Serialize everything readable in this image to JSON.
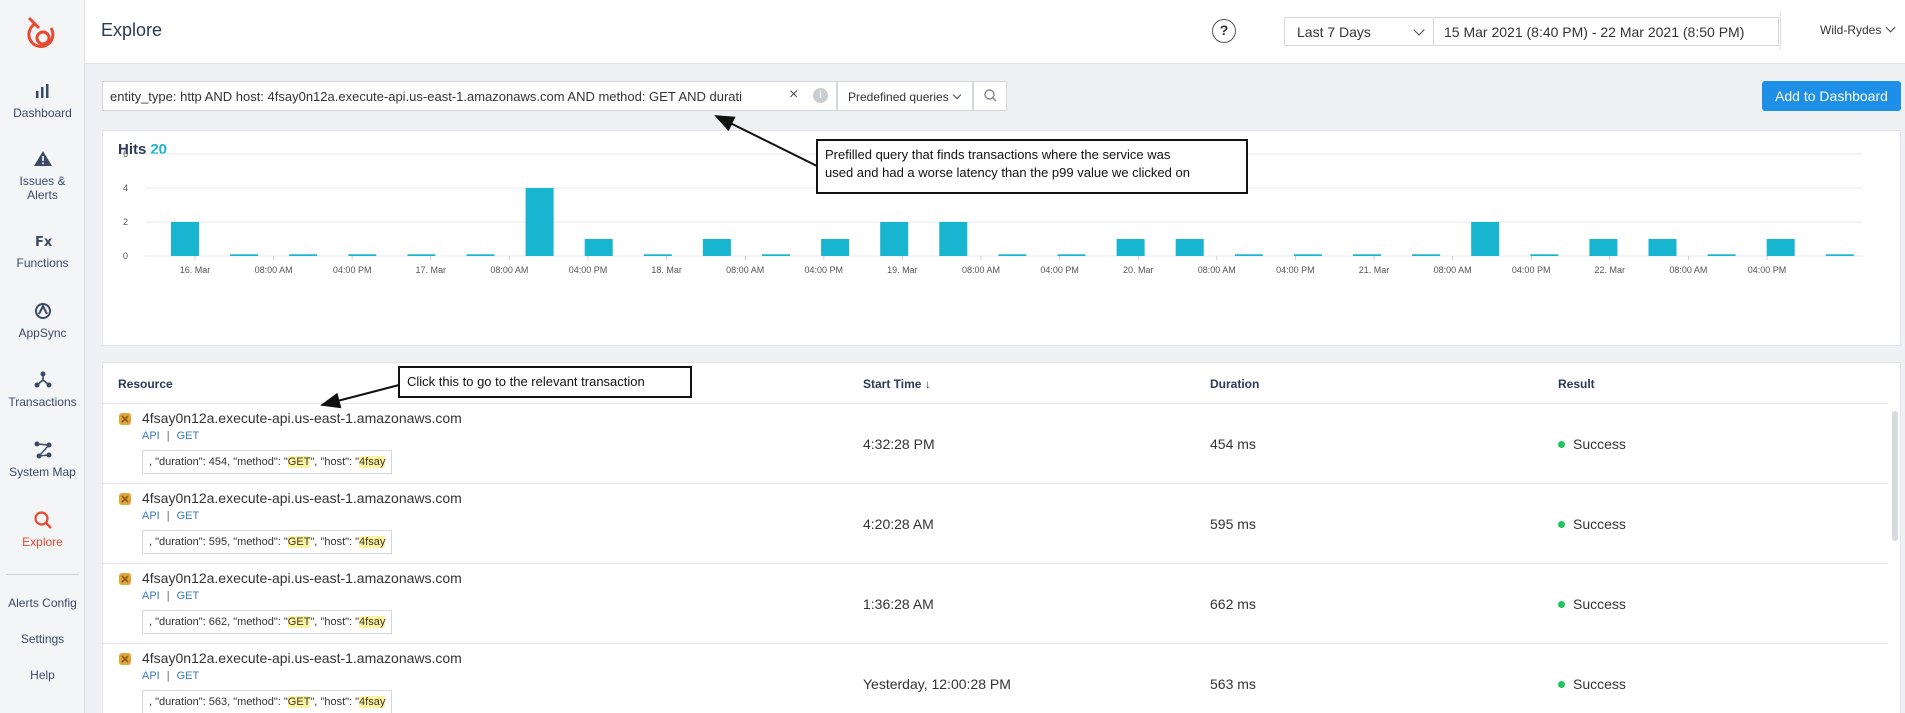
{
  "sidebar": {
    "items": [
      {
        "label": "Dashboard",
        "icon": "bar-chart-icon"
      },
      {
        "label": "Issues &\nAlerts",
        "icon": "warning-icon"
      },
      {
        "label": "Functions",
        "icon": "fx-icon"
      },
      {
        "label": "AppSync",
        "icon": "appsync-icon"
      },
      {
        "label": "Transactions",
        "icon": "transactions-icon"
      },
      {
        "label": "System Map",
        "icon": "system-map-icon"
      },
      {
        "label": "Explore",
        "icon": "search-icon",
        "active": true
      }
    ],
    "bottom": [
      "Alerts Config",
      "Settings",
      "Help"
    ]
  },
  "header": {
    "title": "Explore",
    "help": "?",
    "range": "Last 7 Days",
    "dates": "15 Mar 2021 (8:40 PM) - 22 Mar 2021 (8:50 PM)",
    "account": "Wild-Rydes"
  },
  "query": {
    "text": "entity_type: http AND host: 4fsay0n12a.execute-api.us-east-1.amazonaws.com AND method: GET AND durati",
    "clear": "×",
    "info": "i",
    "predefined": "Predefined queries"
  },
  "add_dashboard": "Add to Dashboard",
  "hits": {
    "label": "Hits",
    "count": "20"
  },
  "chart_data": {
    "type": "bar",
    "title": "Hits",
    "ylim": [
      0,
      6
    ],
    "yticks": [
      0,
      2,
      4,
      6
    ],
    "xtick_labels": [
      "16. Mar",
      "08:00 AM",
      "04:00 PM",
      "17. Mar",
      "08:00 AM",
      "04:00 PM",
      "18. Mar",
      "08:00 AM",
      "04:00 PM",
      "19. Mar",
      "08:00 AM",
      "04:00 PM",
      "20. Mar",
      "08:00 AM",
      "04:00 PM",
      "21. Mar",
      "08:00 AM",
      "04:00 PM",
      "22. Mar",
      "08:00 AM",
      "04:00 PM"
    ],
    "values": [
      2,
      0.1,
      0.1,
      0.1,
      0.1,
      0.1,
      4,
      1,
      0.1,
      1,
      0.1,
      1,
      2,
      2,
      0.1,
      0.1,
      1,
      1,
      0.1,
      0.1,
      0.1,
      0.1,
      2,
      0.1,
      1,
      1,
      0.1,
      1,
      0.1
    ],
    "color": "#17b5cf",
    "grid": true
  },
  "table": {
    "headers": {
      "resource": "Resource",
      "start": "Start Time",
      "sort_icon": "↓",
      "duration": "Duration",
      "result": "Result"
    },
    "rows": [
      {
        "name": "4fsay0n12a.execute-api.us-east-1.amazonaws.com",
        "type": "API",
        "method": "GET",
        "snip_a": ", \"duration\": 454, \"method\": \"",
        "snip_b": "GET",
        "snip_c": "\", \"host\": \"",
        "snip_d": "4fsay",
        "start": "4:32:28 PM",
        "duration": "454 ms",
        "result": "Success"
      },
      {
        "name": "4fsay0n12a.execute-api.us-east-1.amazonaws.com",
        "type": "API",
        "method": "GET",
        "snip_a": ", \"duration\": 595, \"method\": \"",
        "snip_b": "GET",
        "snip_c": "\", \"host\": \"",
        "snip_d": "4fsay",
        "start": "4:20:28 AM",
        "duration": "595 ms",
        "result": "Success"
      },
      {
        "name": "4fsay0n12a.execute-api.us-east-1.amazonaws.com",
        "type": "API",
        "method": "GET",
        "snip_a": ", \"duration\": 662, \"method\": \"",
        "snip_b": "GET",
        "snip_c": "\", \"host\": \"",
        "snip_d": "4fsay",
        "start": "1:36:28 AM",
        "duration": "662 ms",
        "result": "Success"
      },
      {
        "name": "4fsay0n12a.execute-api.us-east-1.amazonaws.com",
        "type": "API",
        "method": "GET",
        "snip_a": ", \"duration\": 563, \"method\": \"",
        "snip_b": "GET",
        "snip_c": "\", \"host\": \"",
        "snip_d": "4fsay",
        "start": "Yesterday, 12:00:28 PM",
        "duration": "563 ms",
        "result": "Success"
      }
    ],
    "separator": "|"
  },
  "annotations": {
    "query_note_1": "Prefilled query that finds transactions where the service was",
    "query_note_2": "used and had a worse latency than the p99 value we clicked on",
    "row_note": "Click this to go to the relevant transaction"
  },
  "colors": {
    "accent": "#1e8fe6",
    "brand": "#e8492f",
    "bar": "#17b5cf",
    "success": "#22c55e"
  }
}
